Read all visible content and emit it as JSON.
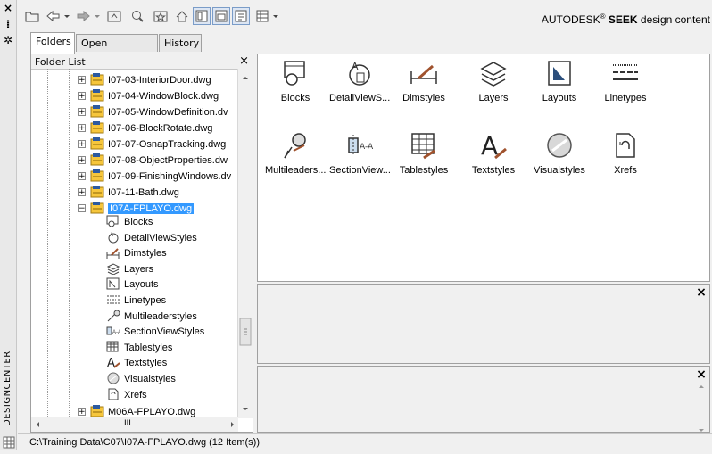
{
  "palette": {
    "accent": "#3399ff",
    "folder_yellow": "#f6c63c",
    "icon_blue": "#2c5aa0",
    "panel_bg": "#f0f0f0"
  },
  "side_strip": {
    "label": "DESIGNCENTER",
    "close_glyph": "×",
    "autohide_glyph": "⁞",
    "properties_glyph": "✲"
  },
  "toolbar": {
    "brand_prefix": "AUTODESK",
    "brand_reg": "®",
    "brand_bold": "SEEK",
    "brand_suffix": " design content"
  },
  "tabs": [
    {
      "label": "Folders",
      "active": true
    },
    {
      "label": "Open Drawings",
      "active": false
    },
    {
      "label": "History",
      "active": false
    }
  ],
  "folder_list": {
    "title": "Folder List",
    "close": "×",
    "files": [
      "I07-03-InteriorDoor.dwg",
      "I07-04-WindowBlock.dwg",
      "I07-05-WindowDefinition.dv",
      "I07-06-BlockRotate.dwg",
      "I07-07-OsnapTracking.dwg",
      "I07-08-ObjectProperties.dw",
      "I07-09-FinishingWindows.dv",
      "I07-11-Bath.dwg",
      "I07A-FPLAYO.dwg"
    ],
    "children": [
      "Blocks",
      "DetailViewStyles",
      "Dimstyles",
      "Layers",
      "Layouts",
      "Linetypes",
      "Multileaderstyles",
      "SectionViewStyles",
      "Tablestyles",
      "Textstyles",
      "Visualstyles",
      "Xrefs"
    ],
    "last_file": "M06A-FPLAYO.dwg",
    "expander_plus": "+",
    "expander_minus": "−",
    "scroll_mid": "III"
  },
  "content_items": [
    {
      "label": "Blocks",
      "icon": "blocks-icon"
    },
    {
      "label": "DetailViewS...",
      "icon": "detail-view-icon"
    },
    {
      "label": "Dimstyles",
      "icon": "dimstyles-icon"
    },
    {
      "label": "Layers",
      "icon": "layers-icon"
    },
    {
      "label": "Layouts",
      "icon": "layouts-icon"
    },
    {
      "label": "Linetypes",
      "icon": "linetypes-icon"
    },
    {
      "label": "Multileaders...",
      "icon": "multileader-icon"
    },
    {
      "label": "SectionView...",
      "icon": "section-view-icon"
    },
    {
      "label": "Tablestyles",
      "icon": "tablestyles-icon"
    },
    {
      "label": "Textstyles",
      "icon": "textstyles-icon"
    },
    {
      "label": "Visualstyles",
      "icon": "visualstyles-icon"
    },
    {
      "label": "Xrefs",
      "icon": "xrefs-icon"
    }
  ],
  "preview_close": "×",
  "desc_close": "×",
  "status": {
    "text": "C:\\Training Data\\C07\\I07A-FPLAYO.dwg (12 Item(s))"
  }
}
